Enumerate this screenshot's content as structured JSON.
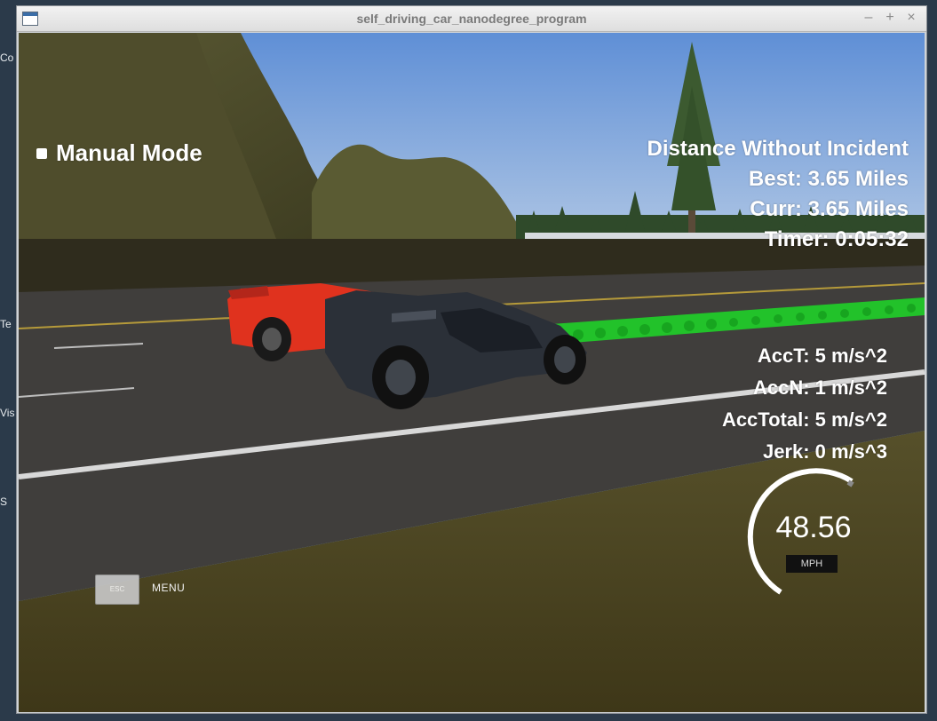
{
  "desktop": {
    "fragments": [
      "Co",
      "Te",
      "Vis",
      "S"
    ]
  },
  "window": {
    "title": "self_driving_car_nanodegree_program",
    "controls": {
      "minimize": "–",
      "maximize": "+",
      "close": "×"
    }
  },
  "hud": {
    "mode_label": "Manual Mode",
    "distance": {
      "heading": "Distance Without Incident",
      "best": "Best: 3.65 Miles",
      "curr": "Curr: 3.65 Miles",
      "timer": "Timer: 0:05:32"
    },
    "accel": {
      "acc_t": "AccT: 5 m/s^2",
      "acc_n": "AccN: 1 m/s^2",
      "acc_total": "AccTotal: 5 m/s^2",
      "jerk": "Jerk: 0 m/s^3"
    },
    "speedometer": {
      "value": "48.56",
      "unit": "MPH"
    },
    "esc_key": "ESC",
    "menu_label": "MENU"
  },
  "colors": {
    "sky": "#74a0d8",
    "hill": "#4b4a2a",
    "road": "#3f3d3a",
    "grass": "#4a4320",
    "path_green": "#22c22a",
    "red_car": "#e0321e",
    "dark_car": "#2b3038"
  }
}
